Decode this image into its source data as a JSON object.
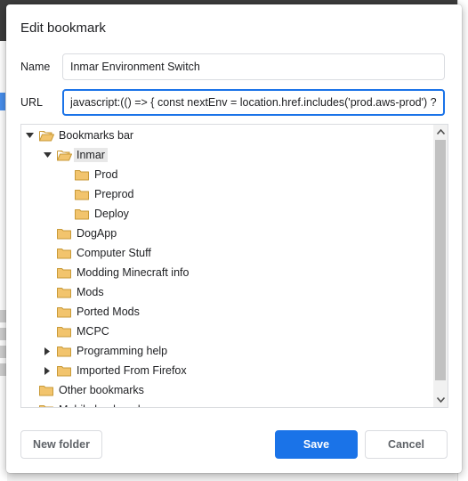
{
  "dialog": {
    "title": "Edit bookmark"
  },
  "name_field": {
    "label": "Name",
    "value": "Inmar Environment Switch"
  },
  "url_field": {
    "label": "URL",
    "value": "javascript:(() => { const nextEnv = location.href.includes('prod.aws-prod') ? loca"
  },
  "tree": {
    "items": [
      {
        "label": "Bookmarks bar",
        "level": 0,
        "arrow": "down",
        "open": true
      },
      {
        "label": "Inmar",
        "level": 1,
        "arrow": "down",
        "open": true,
        "selected": true
      },
      {
        "label": "Prod",
        "level": 2,
        "arrow": "none"
      },
      {
        "label": "Preprod",
        "level": 2,
        "arrow": "none"
      },
      {
        "label": "Deploy",
        "level": 2,
        "arrow": "none"
      },
      {
        "label": "DogApp",
        "level": 1,
        "arrow": "none"
      },
      {
        "label": "Computer Stuff",
        "level": 1,
        "arrow": "none"
      },
      {
        "label": "Modding Minecraft info",
        "level": 1,
        "arrow": "none"
      },
      {
        "label": "Mods",
        "level": 1,
        "arrow": "none"
      },
      {
        "label": "Ported Mods",
        "level": 1,
        "arrow": "none"
      },
      {
        "label": "MCPC",
        "level": 1,
        "arrow": "none"
      },
      {
        "label": "Programming help",
        "level": 1,
        "arrow": "right"
      },
      {
        "label": "Imported From Firefox",
        "level": 1,
        "arrow": "right"
      },
      {
        "label": "Other bookmarks",
        "level": 0,
        "arrow": "none"
      },
      {
        "label": "Mobile bookmarks",
        "level": 0,
        "arrow": "none"
      }
    ]
  },
  "buttons": {
    "new_folder": "New folder",
    "save": "Save",
    "cancel": "Cancel"
  },
  "colors": {
    "accent": "#1a73e8",
    "folder": "#f2c46d",
    "folder_edge": "#c89a38"
  }
}
